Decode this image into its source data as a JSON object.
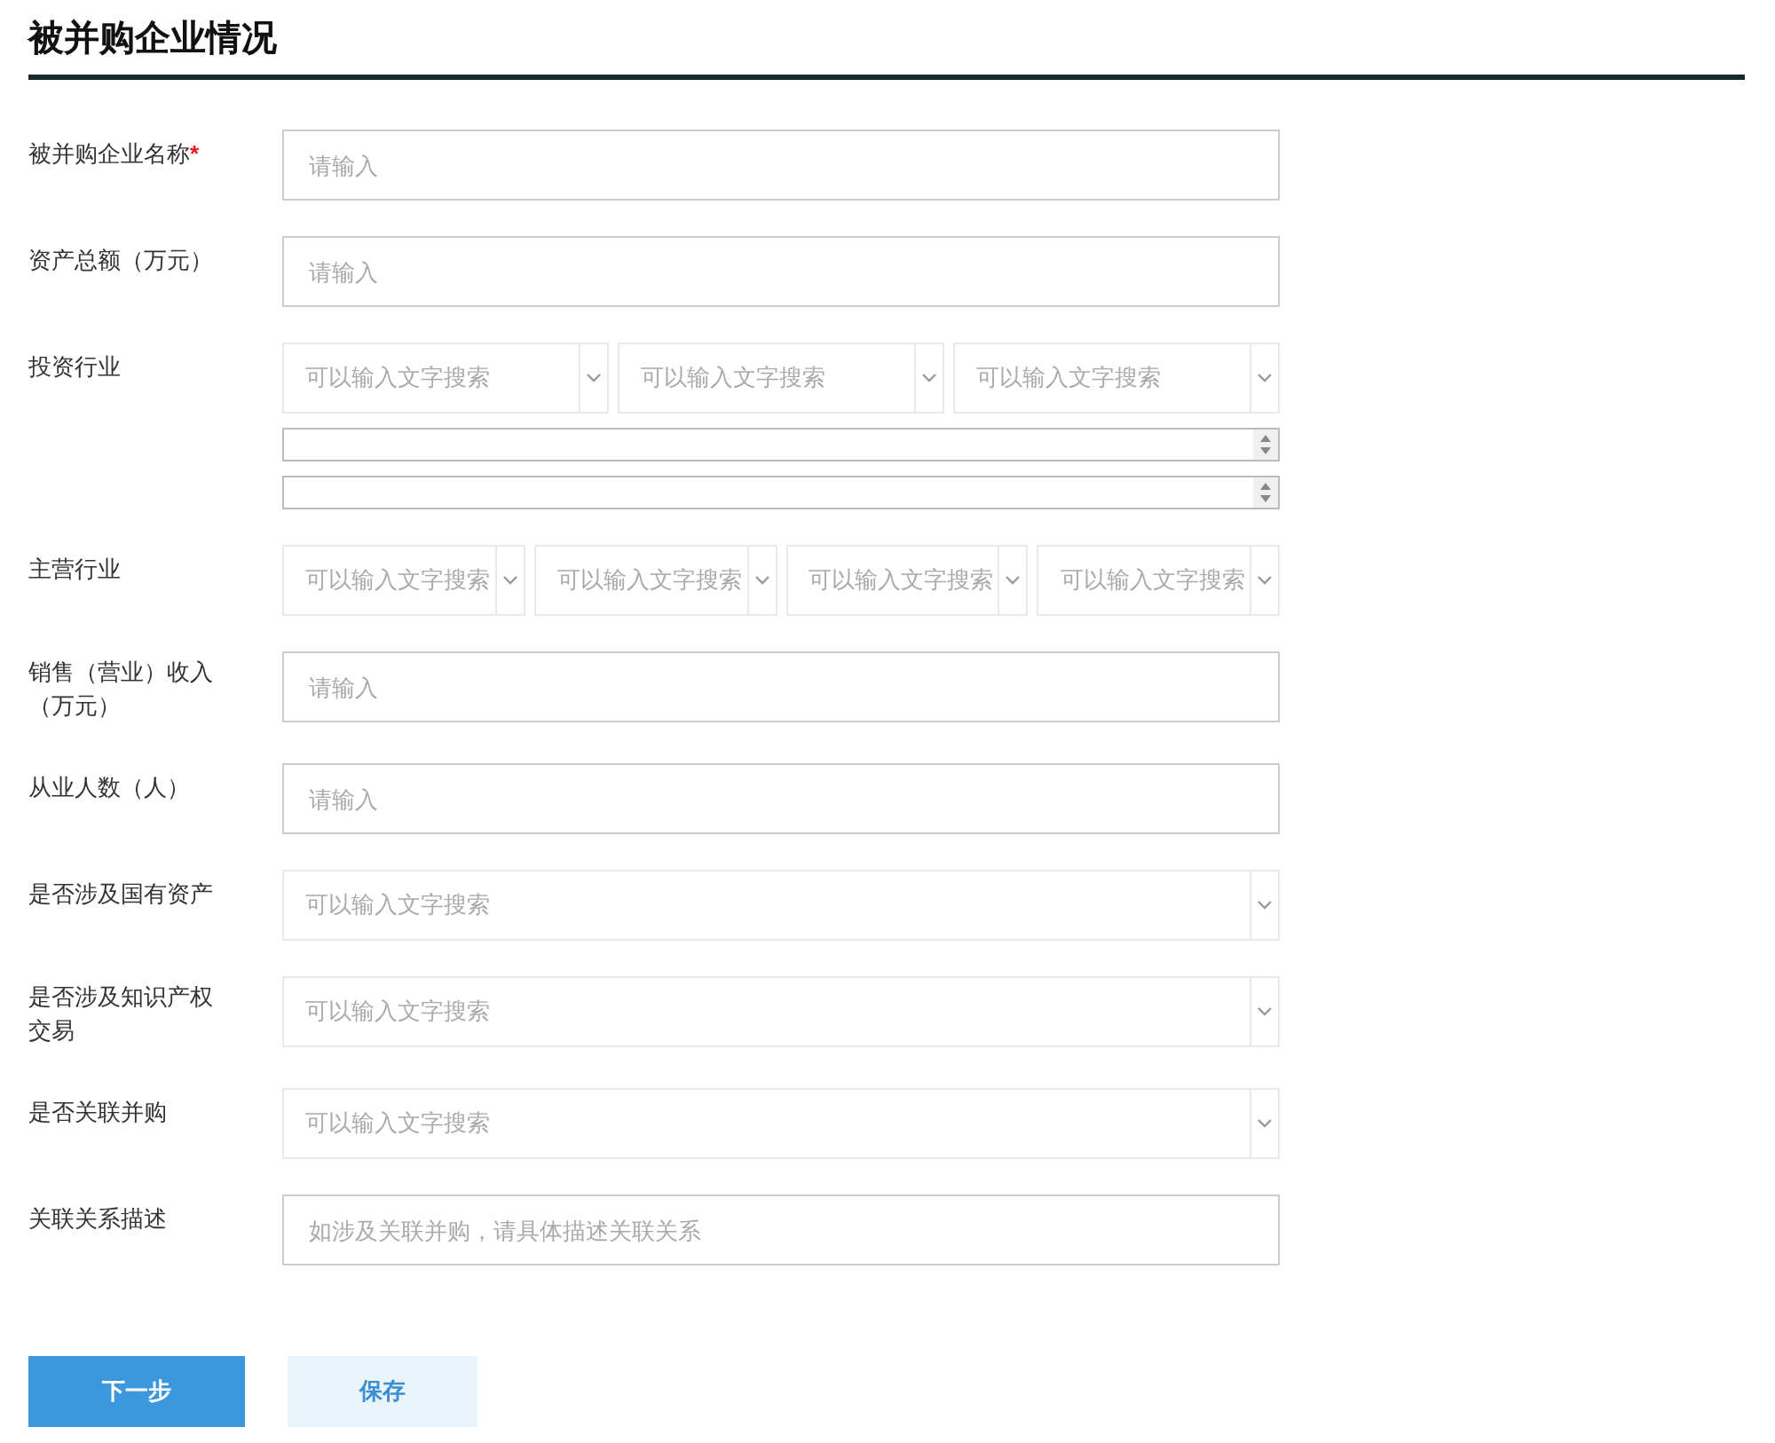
{
  "title": "被并购企业情况",
  "fields": [
    {
      "label": "被并购企业名称",
      "required_mark": "*",
      "kind": "text",
      "placeholder": "请输入"
    },
    {
      "label": "资产总额（万元）",
      "kind": "text",
      "placeholder": "请输入"
    },
    {
      "label": "投资行业",
      "kind": "select_row",
      "selects": [
        {
          "placeholder": "可以输入文字搜索"
        },
        {
          "placeholder": "可以输入文字搜索"
        },
        {
          "placeholder": "可以输入文字搜索"
        }
      ],
      "extra": [
        {
          "kind": "number"
        },
        {
          "kind": "number"
        }
      ]
    },
    {
      "label": "主营行业",
      "kind": "select_row",
      "selects": [
        {
          "placeholder": "可以输入文字搜索"
        },
        {
          "placeholder": "可以输入文字搜索"
        },
        {
          "placeholder": "可以输入文字搜索"
        },
        {
          "placeholder": "可以输入文字搜索"
        }
      ]
    },
    {
      "label": "销售（营业）收入（万元）",
      "kind": "text",
      "placeholder": "请输入"
    },
    {
      "label": "从业人数（人）",
      "kind": "text",
      "placeholder": "请输入"
    },
    {
      "label": "是否涉及国有资产",
      "kind": "select",
      "placeholder": "可以输入文字搜索"
    },
    {
      "label": "是否涉及知识产权交易",
      "kind": "select",
      "placeholder": "可以输入文字搜索"
    },
    {
      "label": "是否关联并购",
      "kind": "select",
      "placeholder": "可以输入文字搜索"
    },
    {
      "label": "关联关系描述",
      "kind": "text",
      "placeholder": "如涉及关联并购，请具体描述关联关系"
    }
  ],
  "buttons": [
    {
      "label": "下一步",
      "kind": "primary"
    },
    {
      "label": "保存",
      "kind": "secondary"
    }
  ]
}
